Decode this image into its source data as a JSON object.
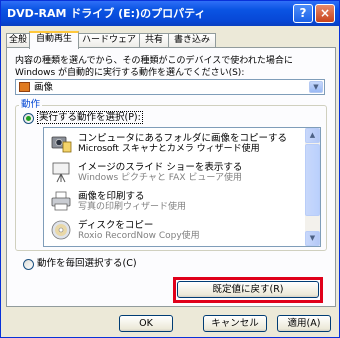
{
  "window": {
    "title": "DVD-RAM ドライブ (E:)のプロパティ",
    "help_button": "?",
    "close_button": "×"
  },
  "tabs": [
    {
      "label": "全般",
      "active": false
    },
    {
      "label": "自動再生",
      "active": true
    },
    {
      "label": "ハードウェア",
      "active": false
    },
    {
      "label": "共有",
      "active": false
    },
    {
      "label": "書き込み",
      "active": false
    }
  ],
  "content_type": {
    "description": "内容の種類を選んでから、その種類がこのデバイスで使われた場合に Windows が自動的に実行する動作を選んでください(S):",
    "selected": "画像"
  },
  "actions": {
    "group_label": "動作",
    "select_option_label": "実行する動作を選択(P):",
    "select_option_checked": true,
    "items": [
      {
        "line1": "コンピュータにあるフォルダに画像をコピーする",
        "line2": "Microsoft スキャナとカメラ ウィザード使用",
        "icon": "camera-copy-icon"
      },
      {
        "line1": "イメージのスライド ショーを表示する",
        "line2": "Windows ピクチャと FAX ビューア使用",
        "icon": "projector-icon"
      },
      {
        "line1": "画像を印刷する",
        "line2": "写真の印刷ウィザード使用",
        "icon": "printer-icon"
      },
      {
        "line1": "ディスクをコピー",
        "line2": "Roxio RecordNow Copy使用",
        "icon": "disc-copy-icon"
      }
    ],
    "prompt_option_label": "動作を毎回選択する(C)",
    "prompt_option_checked": false
  },
  "buttons": {
    "restore_defaults": "既定値に戻す(R)",
    "ok": "OK",
    "cancel": "キャンセル",
    "apply": "適用(A)"
  },
  "colors": {
    "titlebar": "#0a54e3",
    "highlight_border": "#e0001a",
    "group_label": "#0046d5"
  }
}
